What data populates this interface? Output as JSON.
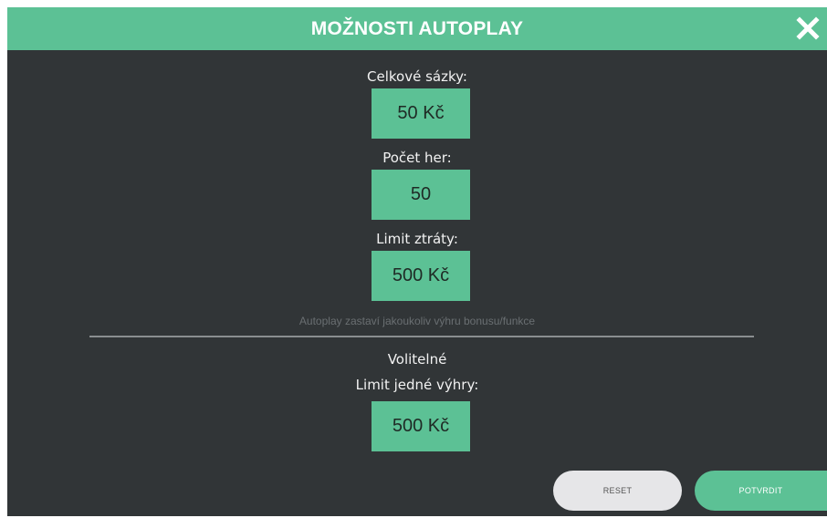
{
  "dialog": {
    "title": "MOŽNOSTI AUTOPLAY",
    "close_icon": "close-icon"
  },
  "fields": {
    "total_bet": {
      "label": "Celkové sázky:",
      "value": "50 Kč"
    },
    "game_count": {
      "label": "Počet her:",
      "value": "50"
    },
    "loss_limit": {
      "label": "Limit ztráty:",
      "value": "500 Kč"
    }
  },
  "note": "Autoplay zastaví jakoukoliv výhru bonusu/funkce",
  "optional": {
    "heading": "Volitelné",
    "single_win_limit": {
      "label": "Limit jedné výhry:",
      "value": "500 Kč"
    }
  },
  "buttons": {
    "reset": "RESET",
    "confirm": "POTVRDIT"
  },
  "colors": {
    "accent": "#5cc195",
    "panel": "#313537",
    "reset_button": "#e6e6e8"
  }
}
